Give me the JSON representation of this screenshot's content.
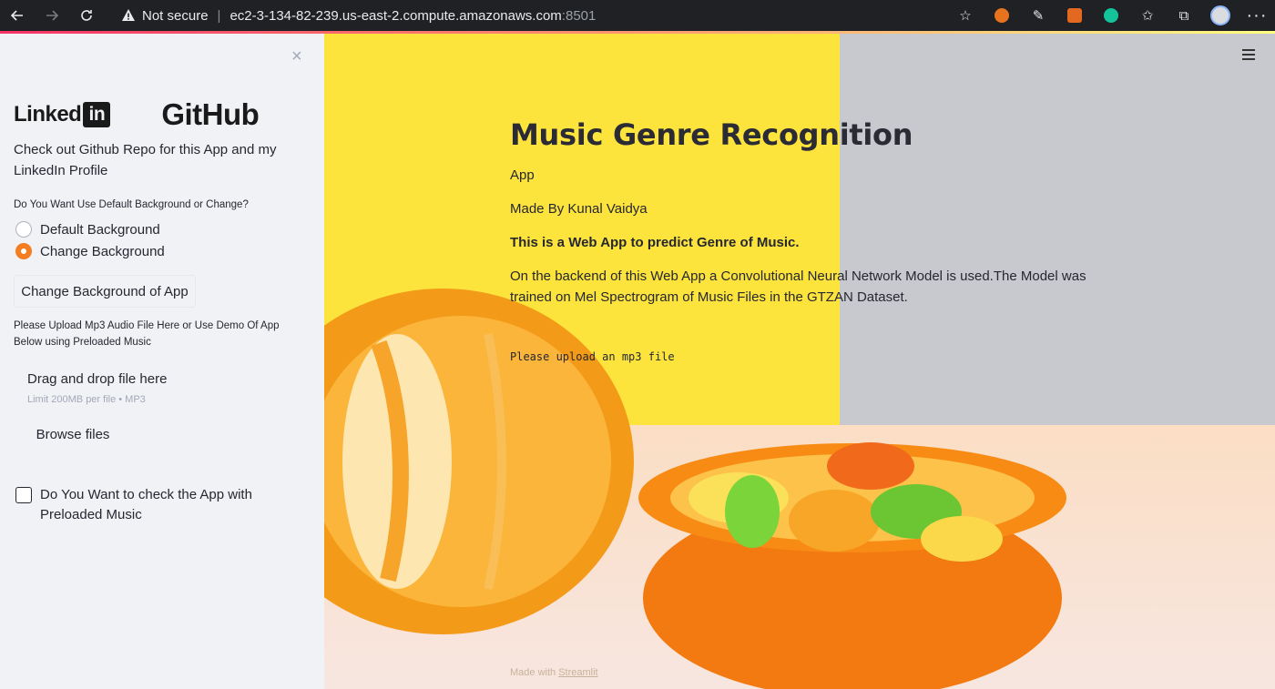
{
  "browser": {
    "security_label": "Not secure",
    "url_host": "ec2-3-134-82-239.us-east-2.compute.amazonaws.com",
    "url_port": ":8501"
  },
  "sidebar": {
    "close_glyph": "×",
    "linkedin_text": "Linked",
    "linkedin_box": "in",
    "github_text": "GitHub",
    "promo_text": "Check out Github Repo for this App and my LinkedIn Profile",
    "radio_title": "Do You Want Use Default Background or Change?",
    "radio_options": [
      {
        "label": "Default Background",
        "selected": false
      },
      {
        "label": "Change Background",
        "selected": true
      }
    ],
    "change_button": "Change Background of App",
    "upload_label": "Please Upload Mp3 Audio File Here or Use Demo Of App Below using Preloaded Music",
    "dropzone": {
      "title": "Drag and drop file here",
      "limit": "Limit 200MB per file • MP3",
      "browse": "Browse files"
    },
    "checkbox_label": "Do You Want to check the App with Preloaded Music",
    "checkbox_checked": false
  },
  "main": {
    "title": "Music Genre Recognition",
    "subtitle": "App",
    "author": "Made By Kunal Vaidya",
    "tagline": "This is a Web App to predict Genre of Music.",
    "description": "On the backend of this Web App a Convolutional Neural Network Model is used.The Model was trained on Mel Spectrogram of Music Files in the GTZAN Dataset.",
    "upload_prompt": "Please upload an mp3 file",
    "footer_prefix": "Made with",
    "footer_link": "Streamlit"
  },
  "colors": {
    "accent": "#f57c1f",
    "sidebar_bg": "#f0f2f6",
    "text": "#262730"
  }
}
